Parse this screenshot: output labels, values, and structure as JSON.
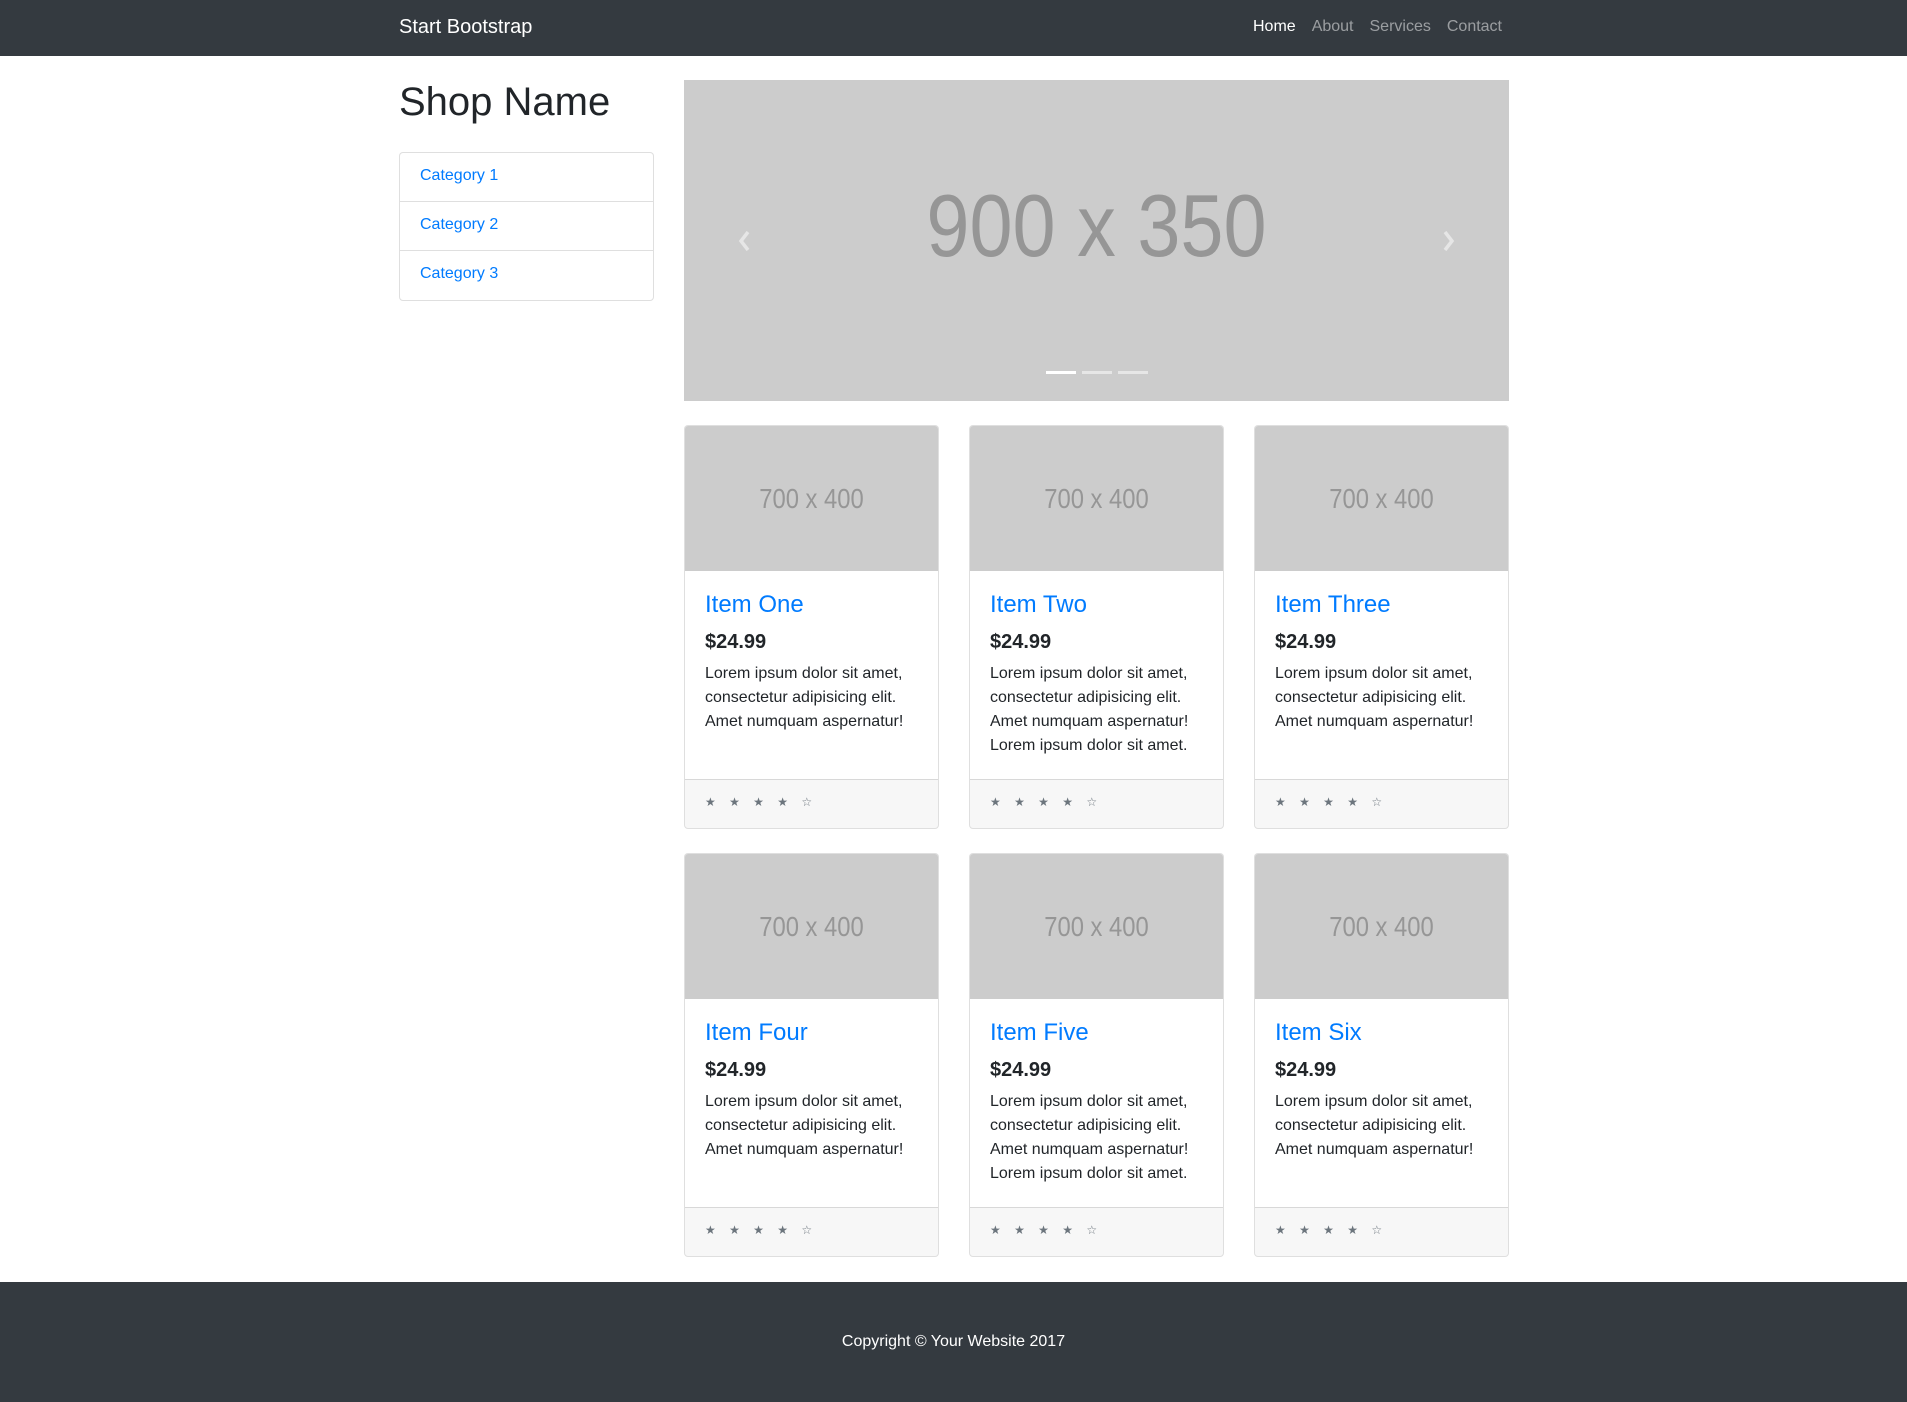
{
  "navbar": {
    "brand": "Start Bootstrap",
    "links": [
      {
        "label": "Home",
        "active": true
      },
      {
        "label": "About",
        "active": false
      },
      {
        "label": "Services",
        "active": false
      },
      {
        "label": "Contact",
        "active": false
      }
    ]
  },
  "sidebar": {
    "shop_name": "Shop Name",
    "categories": [
      "Category 1",
      "Category 2",
      "Category 3"
    ]
  },
  "carousel": {
    "placeholder": "900 x 350",
    "slide_count": 3,
    "active_slide": 1
  },
  "products": [
    {
      "image": "700 x 400",
      "title": "Item One",
      "price": "$24.99",
      "description": "Lorem ipsum dolor sit amet, consectetur adipisicing elit. Amet numquam aspernatur!",
      "rating": "★ ★ ★ ★ ☆"
    },
    {
      "image": "700 x 400",
      "title": "Item Two",
      "price": "$24.99",
      "description": "Lorem ipsum dolor sit amet, consectetur adipisicing elit. Amet numquam aspernatur! Lorem ipsum dolor sit amet.",
      "rating": "★ ★ ★ ★ ☆"
    },
    {
      "image": "700 x 400",
      "title": "Item Three",
      "price": "$24.99",
      "description": "Lorem ipsum dolor sit amet, consectetur adipisicing elit. Amet numquam aspernatur!",
      "rating": "★ ★ ★ ★ ☆"
    },
    {
      "image": "700 x 400",
      "title": "Item Four",
      "price": "$24.99",
      "description": "Lorem ipsum dolor sit amet, consectetur adipisicing elit. Amet numquam aspernatur!",
      "rating": "★ ★ ★ ★ ☆"
    },
    {
      "image": "700 x 400",
      "title": "Item Five",
      "price": "$24.99",
      "description": "Lorem ipsum dolor sit amet, consectetur adipisicing elit. Amet numquam aspernatur! Lorem ipsum dolor sit amet.",
      "rating": "★ ★ ★ ★ ☆"
    },
    {
      "image": "700 x 400",
      "title": "Item Six",
      "price": "$24.99",
      "description": "Lorem ipsum dolor sit amet, consectetur adipisicing elit. Amet numquam aspernatur!",
      "rating": "★ ★ ★ ★ ☆"
    }
  ],
  "footer": {
    "copyright": "Copyright © Your Website 2017"
  },
  "colors": {
    "navbar_bg": "#343a40",
    "link": "#007bff",
    "placeholder_bg": "#cccccc",
    "placeholder_text": "#969696"
  }
}
